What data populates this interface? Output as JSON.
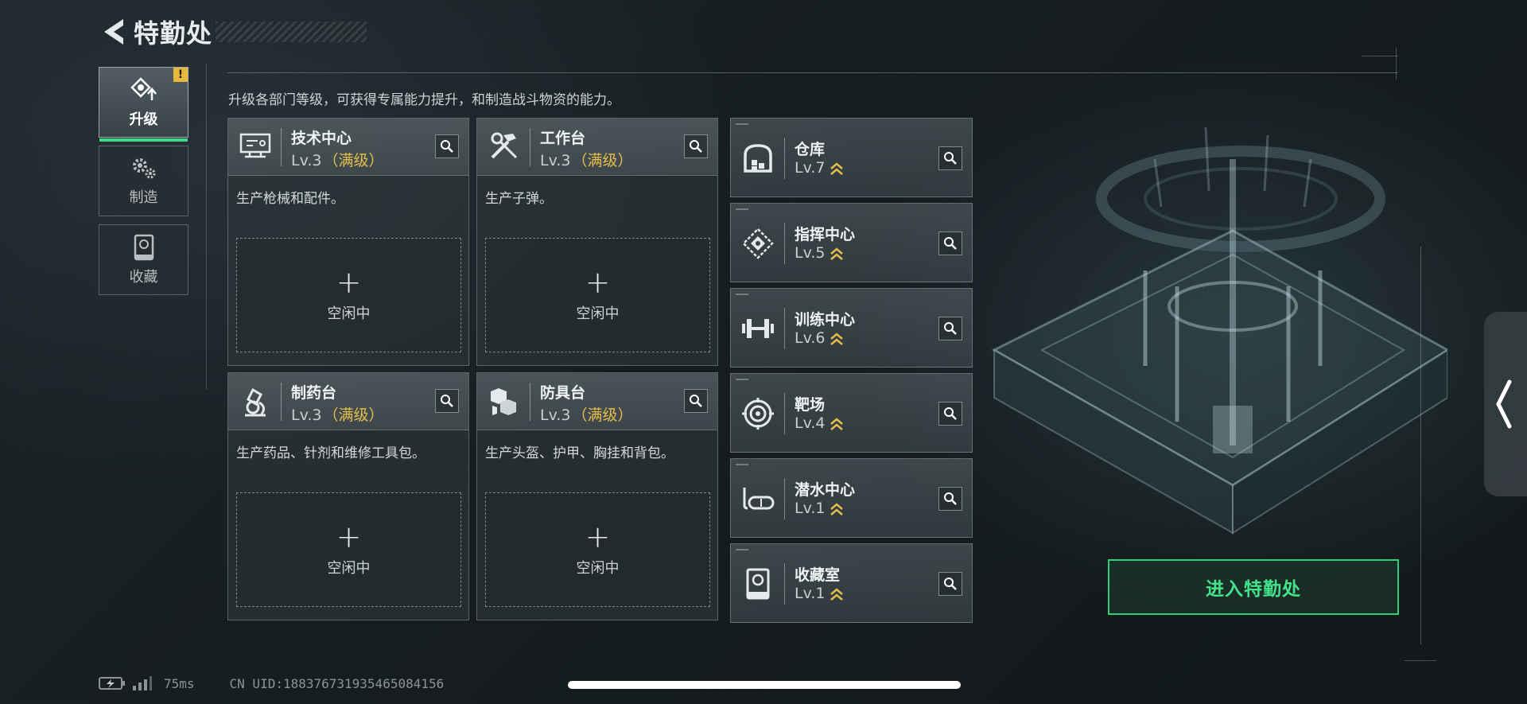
{
  "header": {
    "title": "特勤处",
    "back_icon": "back-arrow-icon"
  },
  "side_tabs": [
    {
      "label": "升级",
      "icon": "upgrade-icon",
      "active": true,
      "badge": "!"
    },
    {
      "label": "制造",
      "icon": "gears-icon",
      "active": false
    },
    {
      "label": "收藏",
      "icon": "collection-icon",
      "active": false
    }
  ],
  "description": "升级各部门等级，可获得专属能力提升，和制造战斗物资的能力。",
  "stations": [
    {
      "name": "技术中心",
      "level": "Lv.3",
      "max_tag": "（满级）",
      "desc": "生产枪械和配件。",
      "idle_label": "空闲中",
      "icon": "computer-icon"
    },
    {
      "name": "工作台",
      "level": "Lv.3",
      "max_tag": "（满级）",
      "desc": "生产子弹。",
      "idle_label": "空闲中",
      "icon": "tools-icon"
    },
    {
      "name": "制药台",
      "level": "Lv.3",
      "max_tag": "（满级）",
      "desc": "生产药品、针剂和维修工具包。",
      "idle_label": "空闲中",
      "icon": "microscope-icon"
    },
    {
      "name": "防具台",
      "level": "Lv.3",
      "max_tag": "（满级）",
      "desc": "生产头盔、护甲、胸挂和背包。",
      "idle_label": "空闲中",
      "icon": "armor-icon"
    }
  ],
  "facilities": [
    {
      "name": "仓库",
      "level": "Lv.7",
      "icon": "warehouse-icon"
    },
    {
      "name": "指挥中心",
      "level": "Lv.5",
      "icon": "command-icon"
    },
    {
      "name": "训练中心",
      "level": "Lv.6",
      "icon": "dumbbell-icon"
    },
    {
      "name": "靶场",
      "level": "Lv.4",
      "icon": "target-icon"
    },
    {
      "name": "潜水中心",
      "level": "Lv.1",
      "icon": "diving-mask-icon"
    },
    {
      "name": "收藏室",
      "level": "Lv.1",
      "icon": "collection-room-icon"
    }
  ],
  "enter_button": "进入特勤处",
  "status": {
    "ping": "75ms",
    "uid": "CN UID:1883767319354650841​56"
  },
  "colors": {
    "accent_green": "#2fd07a",
    "max_level_gold": "#e4be4a",
    "badge_yellow": "#e8b83a"
  }
}
